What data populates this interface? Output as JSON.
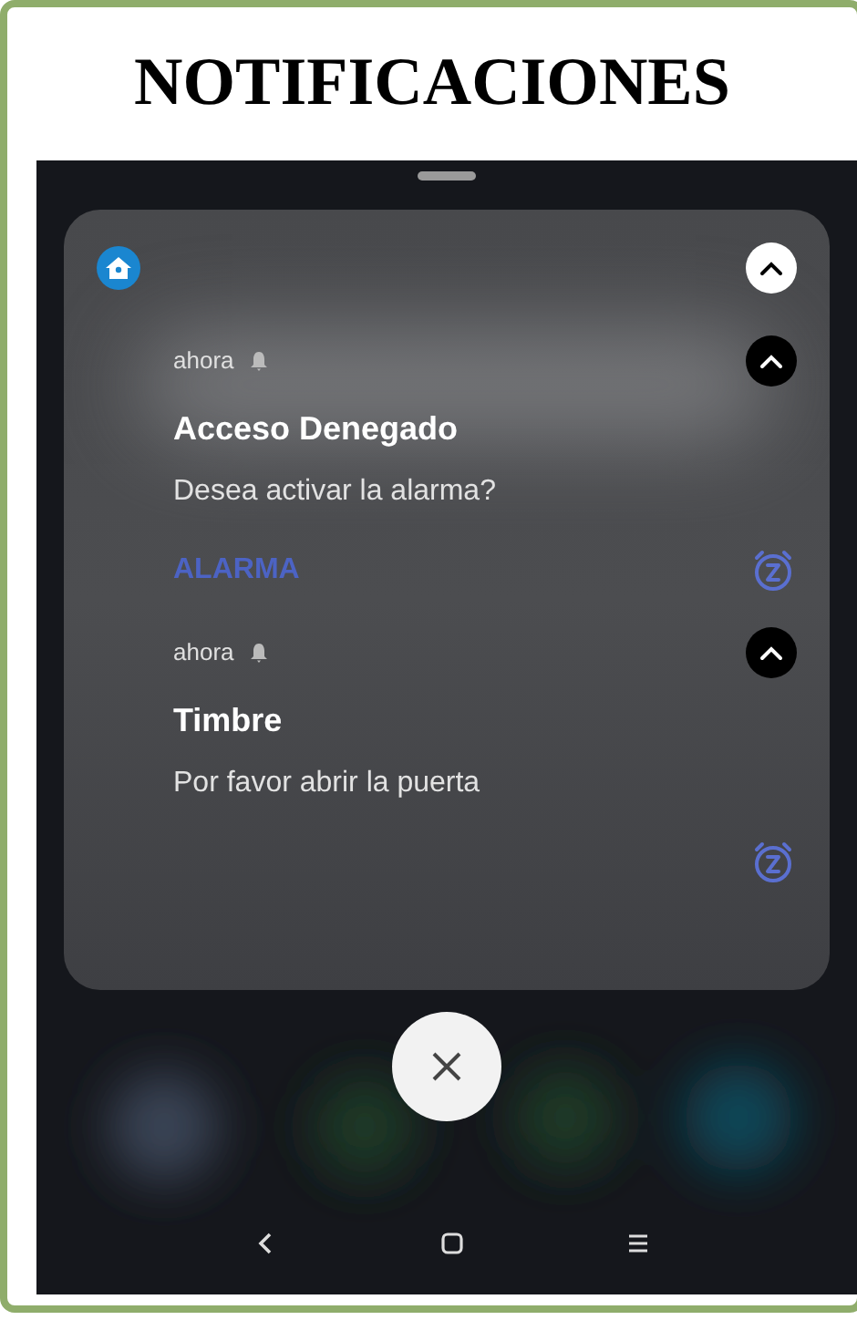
{
  "title": "NOTIFICACIONES",
  "notifications": [
    {
      "time": "ahora",
      "title": "Acceso Denegado",
      "body": "Desea activar la alarma?",
      "action": "ALARMA"
    },
    {
      "time": "ahora",
      "title": "Timbre",
      "body": "Por favor abrir la puerta"
    }
  ]
}
